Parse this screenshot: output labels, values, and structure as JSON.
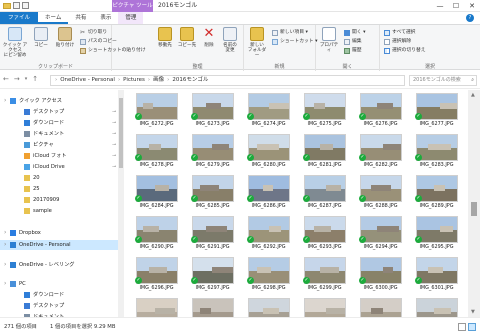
{
  "window": {
    "title": "2016モンゴル",
    "context_tab_group": "ピクチャ ツール",
    "controls": [
      "—",
      "☐",
      "✕"
    ]
  },
  "ribbon_tabs": [
    "ファイル",
    "ホーム",
    "共有",
    "表示",
    "管理"
  ],
  "ribbon": {
    "clipboard": {
      "label": "クリップボード",
      "pin": "クイック アクセス\nにピン留め",
      "copy": "コピー",
      "paste": "貼り付け",
      "cut": "切り取り",
      "copy_path": "パスのコピー",
      "paste_shortcut": "ショートカットの貼り付け"
    },
    "organize": {
      "label": "整理",
      "move_to": "移動先",
      "copy_to": "コピー先",
      "delete": "削除",
      "rename": "名前の\n変更"
    },
    "new": {
      "label": "新規",
      "new_folder": "新しい\nフォルダー",
      "new_item": "新しい項目 ▾",
      "easy_access": "ショートカット ▾"
    },
    "open": {
      "label": "開く",
      "properties": "プロパティ",
      "open": "開く ▾",
      "edit": "編集",
      "history": "履歴"
    },
    "select": {
      "label": "選択",
      "select_all": "すべて選択",
      "select_none": "選択解除",
      "invert": "選択の切り替え"
    }
  },
  "address": {
    "path": [
      "OneDrive - Personal",
      "Pictures",
      "画像",
      "2016モンゴル"
    ],
    "search_placeholder": "2016モンゴルの検索"
  },
  "nav": {
    "items": [
      {
        "label": "クイック アクセス",
        "icon": "star-icon",
        "color": "#3b8ee5",
        "indent": 0,
        "pinned": false
      },
      {
        "label": "デスクトップ",
        "icon": "desktop-icon",
        "color": "#3a7bd5",
        "indent": 1,
        "pinned": true
      },
      {
        "label": "ダウンロード",
        "icon": "download-icon",
        "color": "#2f7ed8",
        "indent": 1,
        "pinned": true
      },
      {
        "label": "ドキュメント",
        "icon": "document-icon",
        "color": "#7c8ea3",
        "indent": 1,
        "pinned": true
      },
      {
        "label": "ピクチャ",
        "icon": "pictures-icon",
        "color": "#4a9ad8",
        "indent": 1,
        "pinned": true
      },
      {
        "label": "iCloud フォト",
        "icon": "icloud-photos-icon",
        "color": "#f0a030",
        "indent": 1,
        "pinned": true
      },
      {
        "label": "iCloud Drive",
        "icon": "icloud-drive-icon",
        "color": "#4aa3e6",
        "indent": 1,
        "pinned": true
      },
      {
        "label": "20",
        "icon": "folder-icon",
        "color": "#e8c34f",
        "indent": 1,
        "pinned": false
      },
      {
        "label": "25",
        "icon": "folder-icon",
        "color": "#e8c34f",
        "indent": 1,
        "pinned": false
      },
      {
        "label": "20170909",
        "icon": "folder-icon",
        "color": "#e8c34f",
        "indent": 1,
        "pinned": false
      },
      {
        "label": "sample",
        "icon": "folder-icon",
        "color": "#e8c34f",
        "indent": 1,
        "pinned": false
      },
      {
        "label": "Dropbox",
        "icon": "dropbox-icon",
        "color": "#2a7de1",
        "indent": 0,
        "pinned": false
      },
      {
        "label": "OneDrive - Personal",
        "icon": "onedrive-icon",
        "color": "#2d7fd3",
        "indent": 0,
        "pinned": false,
        "selected": true
      },
      {
        "label": "OneDrive - レベリング",
        "icon": "onedrive-icon",
        "color": "#2d7fd3",
        "indent": 0,
        "pinned": false
      },
      {
        "label": "PC",
        "icon": "pc-icon",
        "color": "#4a90d9",
        "indent": 0,
        "pinned": false
      },
      {
        "label": "ダウンロード",
        "icon": "download-icon",
        "color": "#2f7ed8",
        "indent": 1,
        "pinned": false
      },
      {
        "label": "デスクトップ",
        "icon": "desktop-icon",
        "color": "#3a7bd5",
        "indent": 1,
        "pinned": false
      },
      {
        "label": "ドキュメント",
        "icon": "document-icon",
        "color": "#7c8ea3",
        "indent": 1,
        "pinned": false
      }
    ]
  },
  "files": [
    "IMG_6272.JPG",
    "IMG_6273.JPG",
    "IMG_6274.JPG",
    "IMG_6275.JPG",
    "IMG_6276.JPG",
    "IMG_6277.JPG",
    "IMG_6278.JPG",
    "IMG_6279.JPG",
    "IMG_6280.JPG",
    "IMG_6281.JPG",
    "IMG_6282.JPG",
    "IMG_6283.JPG",
    "IMG_6284.JPG",
    "IMG_6285.JPG",
    "IMG_6286.JPG",
    "IMG_6287.JPG",
    "IMG_6288.JPG",
    "IMG_6289.JPG",
    "IMG_6290.JPG",
    "IMG_6291.JPG",
    "IMG_6292.JPG",
    "IMG_6293.JPG",
    "IMG_6294.JPG",
    "IMG_6295.JPG",
    "IMG_6296.JPG",
    "IMG_6297.JPG",
    "IMG_6298.JPG",
    "IMG_6299.JPG",
    "IMG_6300.JPG",
    "IMG_6301.JPG",
    "",
    "",
    "",
    "",
    "",
    ""
  ],
  "thumb_styles": [
    [
      "#b9cfe6",
      "#9a8f78"
    ],
    [
      "#c8d8ea",
      "#8f8a70"
    ],
    [
      "#b3cbe4",
      "#a09b82"
    ],
    [
      "#cfdcec",
      "#8e8b6f"
    ],
    [
      "#bcd2e8",
      "#958f74"
    ],
    [
      "#a9c4e2",
      "#857d63"
    ],
    [
      "#c4d6ea",
      "#8b8a72"
    ],
    [
      "#b7cde6",
      "#978d75"
    ],
    [
      "#d0dde9",
      "#9b9378"
    ],
    [
      "#aac3df",
      "#807a64"
    ],
    [
      "#c9d9ea",
      "#978e76"
    ],
    [
      "#b6cde5",
      "#8d8a70"
    ],
    [
      "#a3bfe0",
      "#5a6a7c"
    ],
    [
      "#c2d4e8",
      "#887f69"
    ],
    [
      "#9fbce0",
      "#6e7688"
    ],
    [
      "#b8cfe6",
      "#7f8a92"
    ],
    [
      "#c6d7ea",
      "#9a9178"
    ],
    [
      "#aec8e4",
      "#7c7260"
    ],
    [
      "#bed2e8",
      "#8a8470"
    ],
    [
      "#c9d8ea",
      "#7c7a6a"
    ],
    [
      "#b2cae4",
      "#9c9479"
    ],
    [
      "#cbdaeb",
      "#8c7f6a"
    ],
    [
      "#b4cbe5",
      "#95917a"
    ],
    [
      "#aac4e2",
      "#7e7a68"
    ],
    [
      "#c0d3e8",
      "#8a8069"
    ],
    [
      "#d4e0ec",
      "#6d6f62"
    ],
    [
      "#b5cce5",
      "#998f77"
    ],
    [
      "#c6d6ea",
      "#8d8770"
    ],
    [
      "#b0c8e3",
      "#888268"
    ],
    [
      "#c3d5e9",
      "#7f7864"
    ],
    [
      "#d9d0c4",
      "#b7ad9f"
    ],
    [
      "#c9c3bb",
      "#a49a8d"
    ],
    [
      "#cfd6dd",
      "#a7a094"
    ],
    [
      "#dcd6cf",
      "#b2a898"
    ],
    [
      "#d4cec7",
      "#aba292"
    ],
    [
      "#cbd3da",
      "#9c968b"
    ]
  ],
  "status": {
    "count": "271 個の項目",
    "selected": "1 個の項目を選択  9.29 MB"
  }
}
